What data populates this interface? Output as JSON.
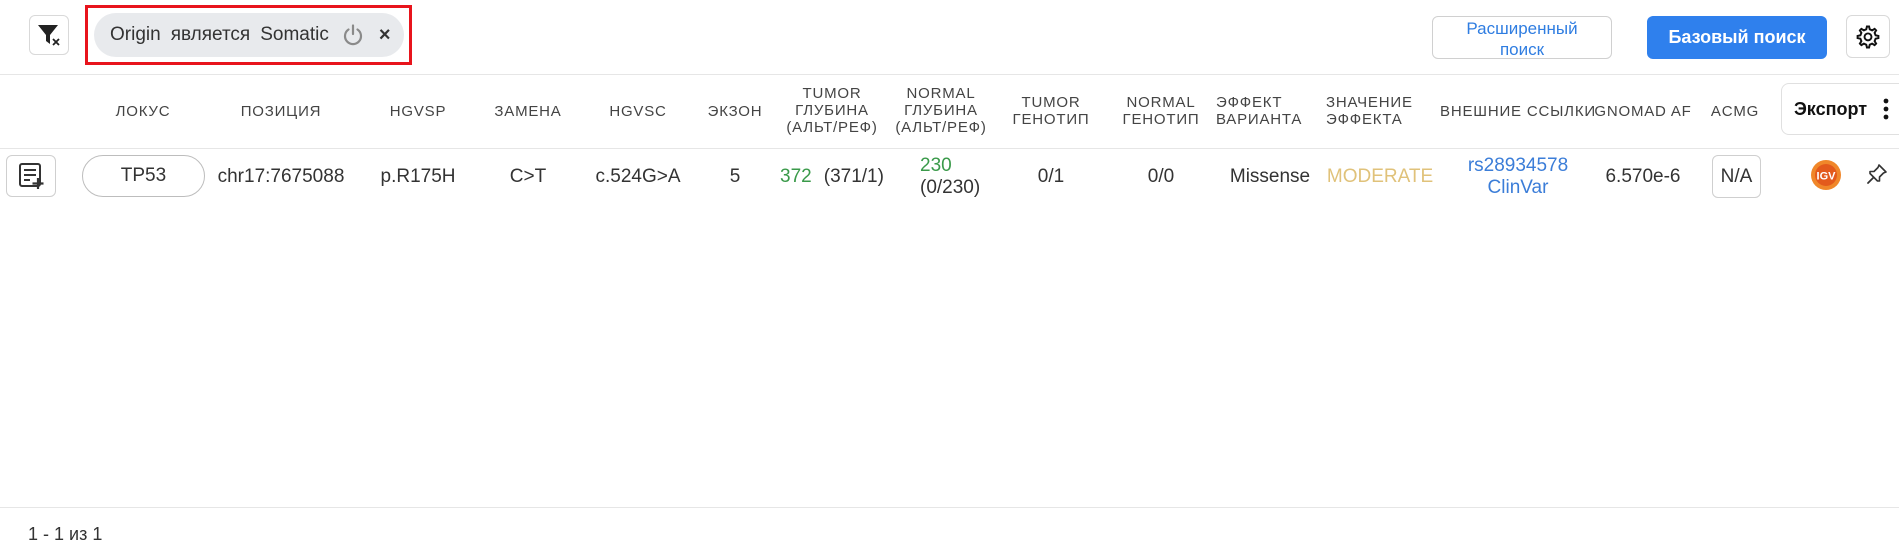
{
  "toolbar": {
    "filter_chip": {
      "field": "Origin",
      "operator": "является",
      "value": "Somatic",
      "close": "×"
    },
    "advanced_search_line1": "Расширенный",
    "advanced_search_line2": "поиск",
    "basic_search": "Базовый поиск"
  },
  "table": {
    "columns": {
      "locus": "ЛОКУС",
      "position": "ПОЗИЦИЯ",
      "hgvsp": "HGVSP",
      "substitution": "ЗАМЕНА",
      "hgvsc": "HGVSC",
      "exon": "ЭКЗОН",
      "tumor_depth": [
        "TUMOR",
        "ГЛУБИНА",
        "(АЛЬТ/РЕФ)"
      ],
      "normal_depth": [
        "NORMAL",
        "ГЛУБИНА",
        "(АЛЬТ/РЕФ)"
      ],
      "tumor_genotype": [
        "TUMOR",
        "ГЕНОТИП"
      ],
      "normal_genotype": [
        "NORMAL",
        "ГЕНОТИП"
      ],
      "variant_effect": [
        "ЭФФЕКТ",
        "ВАРИАНТА"
      ],
      "effect_impact": [
        "ЗНАЧЕНИЕ",
        "ЭФФЕКТА"
      ],
      "external_links": "ВНЕШНИЕ ССЫЛКИ",
      "gnomad_af": "GNOMAD AF",
      "acmg": "ACMG"
    },
    "export_label": "Экспорт",
    "rows": [
      {
        "gene": "TP53",
        "position": "chr17:7675088",
        "hgvsp": "p.R175H",
        "substitution": "C>T",
        "hgvsc": "c.524G>A",
        "exon": "5",
        "tumor_depth_total": "372",
        "tumor_depth_altref": "(371/1)",
        "normal_depth_total": "230",
        "normal_depth_altref": "(0/230)",
        "tumor_genotype": "0/1",
        "normal_genotype": "0/0",
        "variant_effect": "Missense",
        "effect_impact": "MODERATE",
        "link_dbsnp": "rs28934578",
        "link_clinvar": "ClinVar",
        "gnomad_af": "6.570e-6",
        "acmg": "N/A",
        "igv_label": "IGV"
      }
    ]
  },
  "footer": {
    "pagination": "1 - 1 из 1"
  },
  "colors": {
    "accent": "#2f80ed",
    "depth_green": "#3a9a4a",
    "moderate": "#e0c27a",
    "link": "#3b7dd8",
    "highlight": "#e8141c"
  },
  "icons": [
    "filter-clear-icon",
    "power-icon",
    "close-icon",
    "settings-gear-icon",
    "add-note-icon",
    "igv-icon",
    "pin-icon",
    "more-vertical-icon"
  ]
}
